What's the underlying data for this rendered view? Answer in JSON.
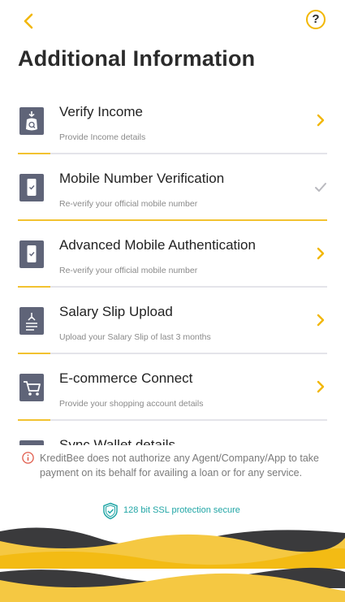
{
  "header": {
    "back_icon": "chevron-left-icon",
    "help_label": "?",
    "title": "Additional Information"
  },
  "items": [
    {
      "title": "Verify Income",
      "subtitle": "Provide Income details",
      "icon": "income-bag-icon",
      "status": "chevron"
    },
    {
      "title": "Mobile Number Verification",
      "subtitle": "Re-verify your official mobile number",
      "icon": "mobile-check-icon",
      "status": "check"
    },
    {
      "title": "Advanced Mobile Authentication",
      "subtitle": "Re-verify your official mobile number",
      "icon": "mobile-check-icon",
      "status": "chevron"
    },
    {
      "title": "Salary Slip Upload",
      "subtitle": "Upload your Salary Slip of last 3 months",
      "icon": "salary-slip-icon",
      "status": "chevron"
    },
    {
      "title": "E-commerce Connect",
      "subtitle": "Provide your shopping account details",
      "icon": "shopping-cart-icon",
      "status": "chevron"
    },
    {
      "title": "Sync Wallet details",
      "subtitle": "",
      "icon": "wallet-icon",
      "status": "chevron"
    }
  ],
  "notice": {
    "text": "KreditBee does not authorize any Agent/Company/App to take payment on its behalf for availing a loan or for any service.",
    "ssl_label": "128 bit SSL protection secure"
  },
  "colors": {
    "accent": "#f2b705",
    "icon_bg": "#5f6478",
    "teal": "#22a6a6",
    "wave_dark": "#3a3a3c",
    "wave_yellow": "#f5c842"
  }
}
